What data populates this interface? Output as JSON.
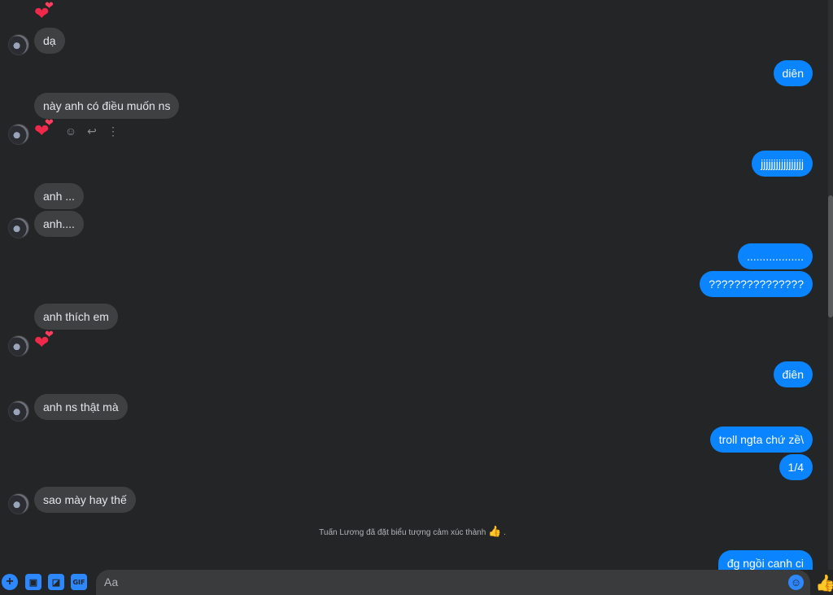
{
  "messages": {
    "in_1": "dạ",
    "in_2": "này anh có điều muốn ns",
    "in_3": "anh ...",
    "in_4": "anh....",
    "in_5": "anh thích em",
    "in_6": "anh ns thật mà",
    "in_7": "sao mày hay thế",
    "out_1": "diên",
    "out_2": "jjjjjjjjjjjjjjjjj",
    "out_3": "..................",
    "out_4": "???????????????",
    "out_5": "điên",
    "out_6": "troll ngta chứ zề\\",
    "out_7": "1/4",
    "out_8": "đg ngồi canh ci"
  },
  "system_notice": "Tuấn Lương đã đặt biểu tượng cảm xúc thành",
  "system_notice_end": ".",
  "composer": {
    "placeholder": "Aa"
  },
  "icons": {
    "reaction": "heart-emoji",
    "react": "smiley-icon",
    "reply": "reply-icon",
    "more": "more-vertical-icon",
    "add": "plus-icon",
    "photo": "photo-icon",
    "sticker": "sticker-icon",
    "gif": "gif-icon",
    "emoji": "emoji-icon",
    "like": "thumbs-up-icon"
  },
  "colors": {
    "background": "#242526",
    "incoming_bubble": "#3e4042",
    "outgoing_bubble": "#0a84ff",
    "accent": "#2d88ff"
  }
}
